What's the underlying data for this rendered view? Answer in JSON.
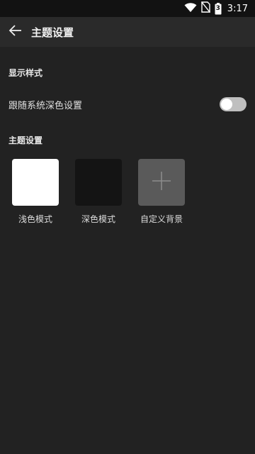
{
  "status_bar": {
    "time": "3:17",
    "battery_level": "3",
    "icons": [
      "wifi-icon",
      "no-sim-icon",
      "battery-charging-icon"
    ]
  },
  "app_bar": {
    "back_icon": "back-arrow-icon",
    "title": "主题设置"
  },
  "display_section": {
    "header": "显示样式",
    "follow_system_dark": {
      "label": "跟随系统深色设置",
      "enabled": false
    }
  },
  "theme_section": {
    "header": "主题设置",
    "options": [
      {
        "label": "浅色模式",
        "swatch_color": "#ffffff"
      },
      {
        "label": "深色模式",
        "swatch_color": "#141414"
      },
      {
        "label": "自定义背景",
        "swatch_color": "#5a5a5a",
        "icon": "plus-icon"
      }
    ]
  },
  "colors": {
    "background": "#222222",
    "app_bar": "#2a2a2a",
    "status_bar": "#121212"
  }
}
